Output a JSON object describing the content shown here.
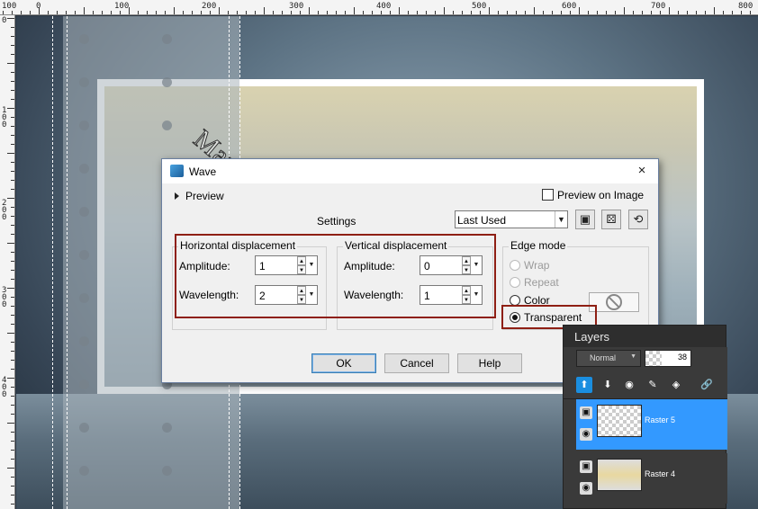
{
  "ruler_top_labels": [
    "100",
    "0",
    "100",
    "200",
    "300",
    "400",
    "500",
    "600",
    "700",
    "800"
  ],
  "ruler_left_labels": [
    "0",
    "100",
    "200",
    "300",
    "400"
  ],
  "watermark": "MaryTutorials©",
  "dialog": {
    "title": "Wave",
    "close_icon": "×",
    "preview_label": "Preview",
    "preview_on_image_label": "Preview on Image",
    "settings_label": "Settings",
    "settings_value": "Last Used",
    "horizontal": {
      "title": "Horizontal displacement",
      "amplitude_label": "Amplitude:",
      "amplitude_value": "1",
      "wavelength_label": "Wavelength:",
      "wavelength_value": "2"
    },
    "vertical": {
      "title": "Vertical displacement",
      "amplitude_label": "Amplitude:",
      "amplitude_value": "0",
      "wavelength_label": "Wavelength:",
      "wavelength_value": "1"
    },
    "edge_mode": {
      "title": "Edge mode",
      "wrap": "Wrap",
      "repeat": "Repeat",
      "color": "Color",
      "transparent": "Transparent",
      "selected": "Transparent"
    },
    "ok": "OK",
    "cancel": "Cancel",
    "help": "Help"
  },
  "layers": {
    "title": "Layers",
    "blend_mode": "Normal",
    "opacity": "38",
    "items": [
      {
        "name": "Raster 5",
        "selected": true
      },
      {
        "name": "Raster 4",
        "selected": false
      }
    ]
  },
  "colors": {
    "highlight": "#3399ff",
    "annotation_red": "#8e1f14",
    "panel_dark": "#3a3a3a"
  },
  "icons": [
    "app-icon",
    "save-preset-icon",
    "random-icon",
    "reset-icon",
    "eye-icon",
    "link-icon",
    "new-layer-icon"
  ]
}
